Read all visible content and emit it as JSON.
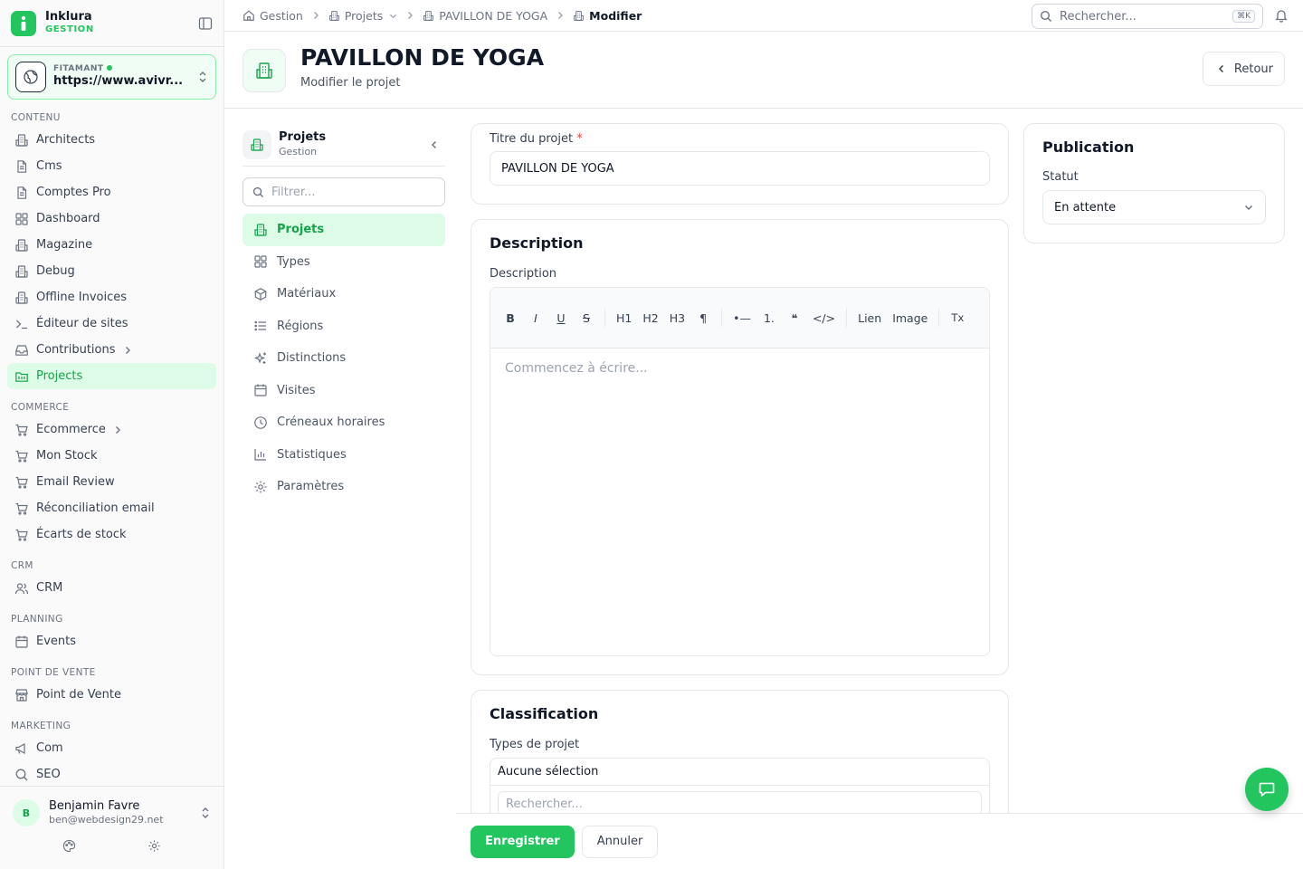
{
  "brand": {
    "name": "Inklura",
    "sub": "GESTION"
  },
  "site": {
    "label": "FITAMANT",
    "url": "https://www.avivr..."
  },
  "sidebar": {
    "sections": [
      {
        "title": "CONTENU",
        "items": [
          {
            "label": "Architects",
            "icon": "building-icon"
          },
          {
            "label": "Cms",
            "icon": "file-icon"
          },
          {
            "label": "Comptes Pro",
            "icon": "file-icon"
          },
          {
            "label": "Dashboard",
            "icon": "grid-icon"
          },
          {
            "label": "Magazine",
            "icon": "building-icon"
          },
          {
            "label": "Debug",
            "icon": "building-icon"
          },
          {
            "label": "Offline Invoices",
            "icon": "building-icon"
          },
          {
            "label": "Éditeur de sites",
            "icon": "terminal-icon"
          },
          {
            "label": "Contributions",
            "icon": "inbox-icon",
            "has_children": true
          },
          {
            "label": "Projects",
            "icon": "folder-icon",
            "active": true
          }
        ]
      },
      {
        "title": "COMMERCE",
        "items": [
          {
            "label": "Ecommerce",
            "icon": "cart-icon",
            "has_children": true
          },
          {
            "label": "Mon Stock",
            "icon": "cart-icon"
          },
          {
            "label": "Email Review",
            "icon": "cart-icon"
          },
          {
            "label": "Réconciliation email",
            "icon": "cart-icon"
          },
          {
            "label": "Écarts de stock",
            "icon": "cart-icon"
          }
        ]
      },
      {
        "title": "CRM",
        "items": [
          {
            "label": "CRM",
            "icon": "users-icon"
          }
        ]
      },
      {
        "title": "PLANNING",
        "items": [
          {
            "label": "Events",
            "icon": "calendar-icon"
          }
        ]
      },
      {
        "title": "POINT DE VENTE",
        "items": [
          {
            "label": "Point de Vente",
            "icon": "store-icon"
          }
        ]
      },
      {
        "title": "MARKETING",
        "items": [
          {
            "label": "Com",
            "icon": "megaphone-icon"
          },
          {
            "label": "SEO",
            "icon": "search-icon"
          }
        ]
      }
    ]
  },
  "user": {
    "initial": "B",
    "name": "Benjamin Favre",
    "email": "ben@webdesign29.net"
  },
  "breadcrumb": [
    {
      "label": "Gestion",
      "icon": "home-icon"
    },
    {
      "label": "Projets",
      "icon": "building-icon",
      "dropdown": true
    },
    {
      "label": "PAVILLON DE YOGA",
      "icon": "building-icon"
    },
    {
      "label": "Modifier",
      "icon": "building-icon",
      "current": true
    }
  ],
  "search": {
    "placeholder": "Rechercher...",
    "shortcut": "⌘K"
  },
  "page": {
    "title": "PAVILLON DE YOGA",
    "subtitle": "Modifier le projet",
    "back_label": "Retour"
  },
  "subnav": {
    "title": "Projets",
    "subtitle": "Gestion",
    "filter_placeholder": "Filtrer...",
    "items": [
      {
        "label": "Projets",
        "icon": "building-icon",
        "active": true
      },
      {
        "label": "Types",
        "icon": "grid-icon"
      },
      {
        "label": "Matériaux",
        "icon": "box-icon"
      },
      {
        "label": "Régions",
        "icon": "list-icon"
      },
      {
        "label": "Distinctions",
        "icon": "sparkles-icon"
      },
      {
        "label": "Visites",
        "icon": "calendar-icon"
      },
      {
        "label": "Créneaux horaires",
        "icon": "clock-icon"
      },
      {
        "label": "Statistiques",
        "icon": "chart-icon"
      },
      {
        "label": "Paramètres",
        "icon": "gear-icon"
      }
    ]
  },
  "form": {
    "title_label": "Titre du projet",
    "required_mark": "*",
    "title_value": "PAVILLON DE YOGA",
    "description": {
      "card_title": "Description",
      "label": "Description",
      "toolbar": {
        "bold": "B",
        "italic": "I",
        "underline": "U",
        "strike": "S",
        "h1": "H1",
        "h2": "H2",
        "h3": "H3",
        "paragraph": "¶",
        "bullet": "•—",
        "ordered": "1.",
        "quote": "❝",
        "code": "</>",
        "link": "Lien",
        "image": "Image",
        "clear": "Tx"
      },
      "placeholder": "Commencez à écrire..."
    },
    "classification": {
      "card_title": "Classification",
      "types_label": "Types de projet",
      "types_value": "Aucune sélection",
      "types_search_placeholder": "Rechercher..."
    }
  },
  "publication": {
    "title": "Publication",
    "status_label": "Statut",
    "status_value": "En attente"
  },
  "actions": {
    "save": "Enregistrer",
    "cancel": "Annuler"
  }
}
